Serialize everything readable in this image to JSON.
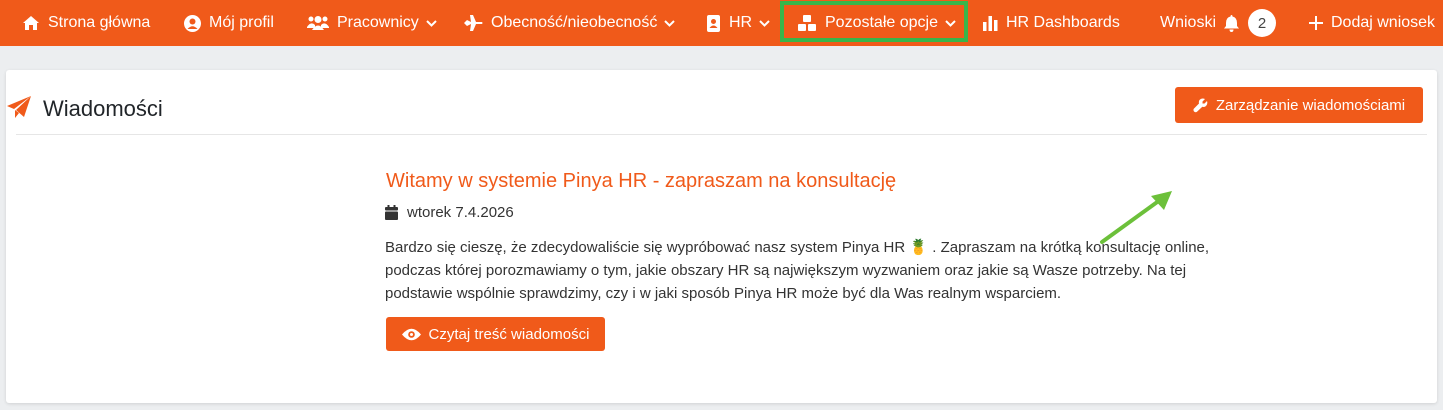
{
  "nav": {
    "home": "Strona główna",
    "profile": "Mój profil",
    "employees": "Pracownicy",
    "attendance": "Obecność/nieobecność",
    "hr": "HR",
    "other_options": "Pozostałe opcje",
    "hr_dashboards": "HR Dashboards",
    "requests": "Wnioski",
    "requests_count": "2",
    "add_request": "Dodaj wniosek"
  },
  "page": {
    "title": "Wiadomości",
    "manage_button": "Zarządzanie wiadomościami"
  },
  "message": {
    "title": "Witamy w systemie Pinya HR - zapraszam na konsultację",
    "date": "wtorek 7.4.2026",
    "body_part1": "Bardzo się cieszę, że zdecydowaliście się wypróbować nasz system Pinya HR ",
    "body_emoji": "🍍",
    "body_part2": " . Zapraszam na krótką konsultację online, podczas której porozmawiamy o tym, jakie obszary HR są największym wyzwaniem oraz jakie są Wasze potrzeby. Na tej podstawie wspólnie sprawdzimy, czy i w jaki sposób Pinya HR może być dla Was realnym wsparciem.",
    "read_button": "Czytaj treść wiadomości"
  },
  "colors": {
    "accent": "#f05a1a",
    "highlight_box": "#39b54a",
    "annotation_arrow": "#6cc03a"
  }
}
